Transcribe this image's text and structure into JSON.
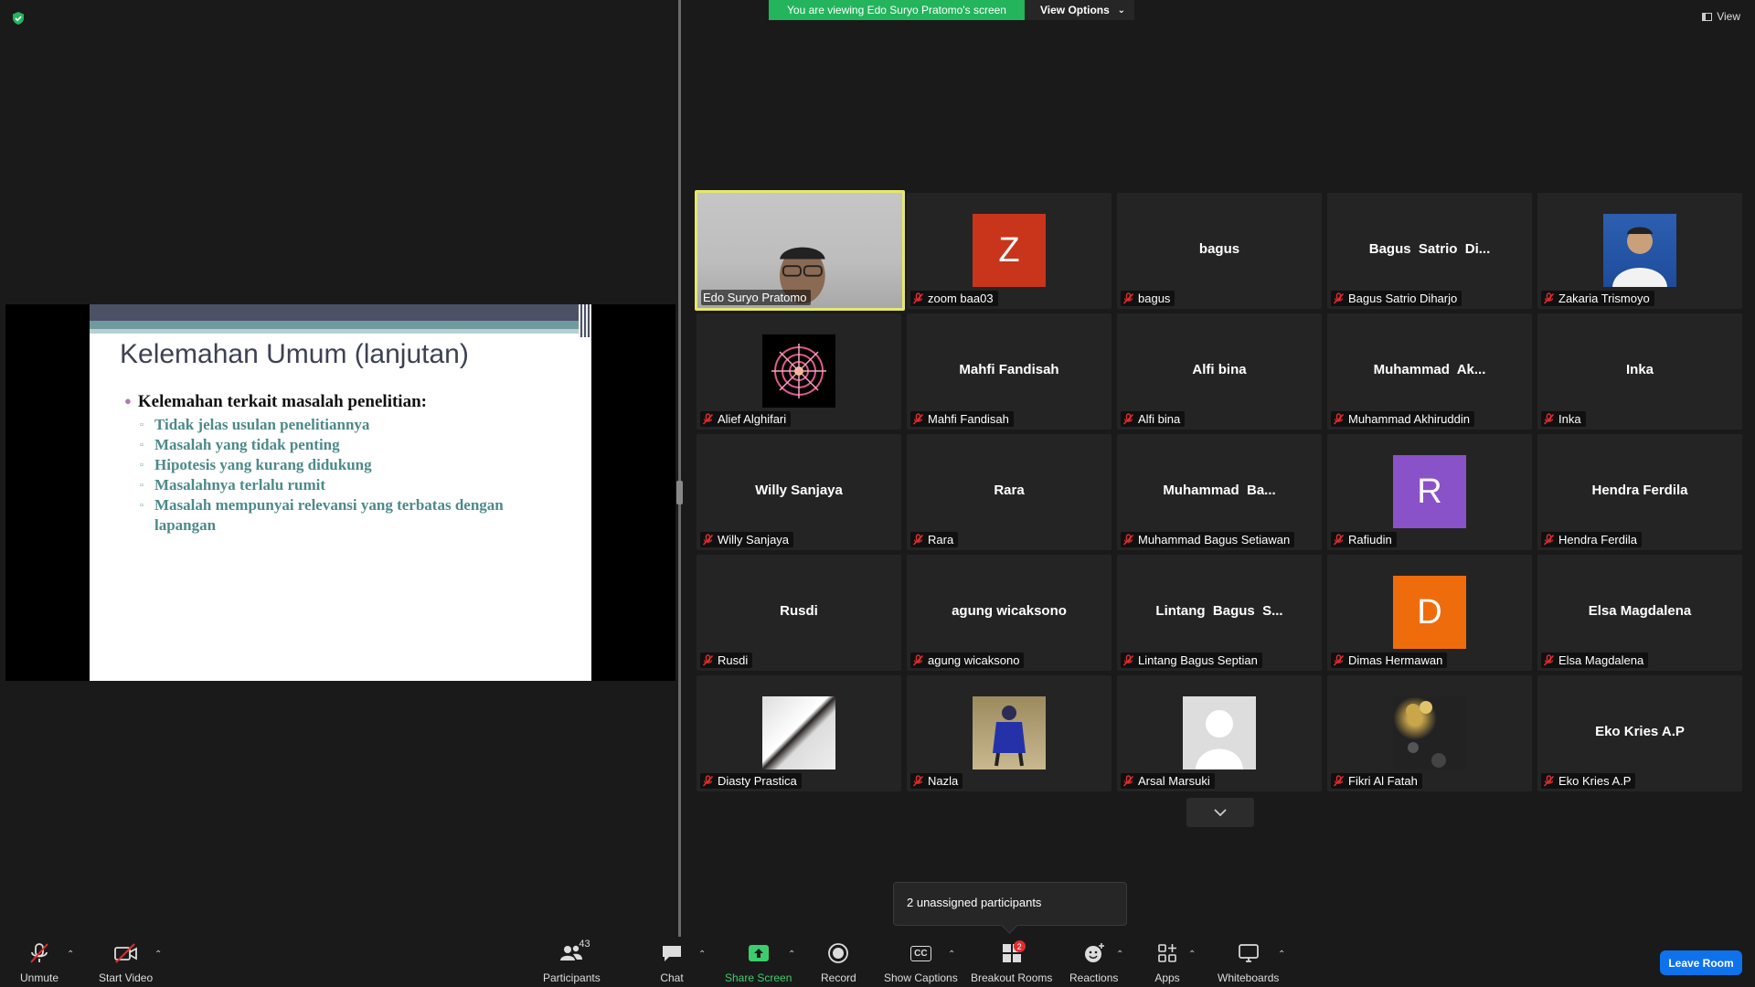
{
  "colors": {
    "banner_green": "#23b45c",
    "leave_blue": "#0e72ed",
    "active_border": "#e5e86a",
    "mute_red": "#e02d2d"
  },
  "banner": {
    "viewing_text": "You are viewing Edo Suryo Pratomo's screen",
    "view_options_label": "View Options"
  },
  "view_button": {
    "label": "View",
    "icon": "gallery-view-icon"
  },
  "slide": {
    "title": "Kelemahan Umum (lanjutan)",
    "main_bullet": "Kelemahan terkait masalah penelitian:",
    "sub_bullets": [
      "Tidak jelas usulan penelitiannya",
      "Masalah yang tidak penting",
      "Hipotesis yang kurang didukung",
      "Masalahnya terlalu rumit",
      "Masalah mempunyai relevansi yang terbatas dengan lapangan"
    ]
  },
  "participants": [
    {
      "name": "Edo Suryo Pratomo",
      "display": "",
      "kind": "video"
    },
    {
      "name": "zoom baa03",
      "display": "Z",
      "kind": "letter",
      "color": "#c8351a"
    },
    {
      "name": "bagus",
      "display": "bagus",
      "kind": "text"
    },
    {
      "name": "Bagus Satrio Diharjo",
      "display": "Bagus  Satrio  Di...",
      "kind": "text"
    },
    {
      "name": "Zakaria Trismoyo",
      "display": "",
      "kind": "photo-person"
    },
    {
      "name": "Alief Alghifari",
      "display": "",
      "kind": "photo-mandala"
    },
    {
      "name": "Mahfi Fandisah",
      "display": "Mahfi Fandisah",
      "kind": "text"
    },
    {
      "name": "Alfi bina",
      "display": "Alfi bina",
      "kind": "text"
    },
    {
      "name": "Muhammad Akhiruddin",
      "display": "Muhammad  Ak...",
      "kind": "text"
    },
    {
      "name": "Inka",
      "display": "Inka",
      "kind": "text"
    },
    {
      "name": "Willy Sanjaya",
      "display": "Willy Sanjaya",
      "kind": "text"
    },
    {
      "name": "Rara",
      "display": "Rara",
      "kind": "text"
    },
    {
      "name": "Muhammad Bagus Setiawan",
      "display": "Muhammad  Ba...",
      "kind": "text"
    },
    {
      "name": "Rafiudin",
      "display": "R",
      "kind": "letter",
      "color": "#8a52c8"
    },
    {
      "name": "Hendra Ferdila",
      "display": "Hendra Ferdila",
      "kind": "text"
    },
    {
      "name": "Rusdi",
      "display": "Rusdi",
      "kind": "text"
    },
    {
      "name": "agung wicaksono",
      "display": "agung wicaksono",
      "kind": "text"
    },
    {
      "name": "Lintang Bagus Septian",
      "display": "Lintang  Bagus  S...",
      "kind": "text"
    },
    {
      "name": "Dimas Hermawan",
      "display": "D",
      "kind": "letter",
      "color": "#ef6c0c"
    },
    {
      "name": "Elsa Magdalena",
      "display": "Elsa Magdalena",
      "kind": "text"
    },
    {
      "name": "Diasty Prastica",
      "display": "",
      "kind": "photo-hands"
    },
    {
      "name": "Nazla",
      "display": "",
      "kind": "photo-blue"
    },
    {
      "name": "Arsal Marsuki",
      "display": "",
      "kind": "photo-default"
    },
    {
      "name": "Fikri Al Fatah",
      "display": "",
      "kind": "photo-party"
    },
    {
      "name": "Eko Kries A.P",
      "display": "Eko Kries A.P",
      "kind": "text"
    }
  ],
  "unassigned_text": "2 unassigned participants",
  "toolbar": {
    "unmute": "Unmute",
    "start_video": "Start Video",
    "participants": "Participants",
    "participants_count": "43",
    "chat": "Chat",
    "share_screen": "Share Screen",
    "record": "Record",
    "captions": "Show Captions",
    "captions_badge": "CC",
    "breakout": "Breakout Rooms",
    "breakout_badge": "2",
    "reactions": "Reactions",
    "apps": "Apps",
    "whiteboards": "Whiteboards",
    "leave": "Leave Room"
  }
}
